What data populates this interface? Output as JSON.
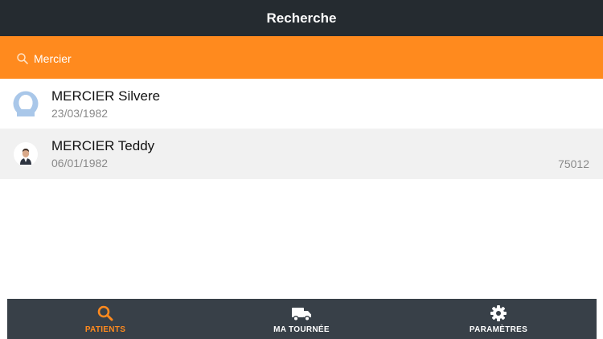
{
  "navbar": {
    "title": "Recherche"
  },
  "search": {
    "value": "Mercier",
    "icon": "search-icon"
  },
  "patients": [
    {
      "name": "MERCIER Silvere",
      "dob": "23/03/1982",
      "postal_code": "",
      "avatar": "default-avatar-icon"
    },
    {
      "name": "MERCIER Teddy",
      "dob": "06/01/1982",
      "postal_code": "75012",
      "avatar": "photo-avatar"
    }
  ],
  "tabs": [
    {
      "label": "PATIENTS",
      "icon": "search-icon",
      "active": true
    },
    {
      "label": "MA TOURNÉE",
      "icon": "truck-icon",
      "active": false
    },
    {
      "label": "PARAMÈTRES",
      "icon": "gear-icon",
      "active": false
    }
  ],
  "colors": {
    "navbar": "#252b30",
    "accent": "#ff8a1e",
    "tabbar": "#384048",
    "row_alt": "#f1f1f1",
    "secondary_text": "#8a8a8a"
  }
}
